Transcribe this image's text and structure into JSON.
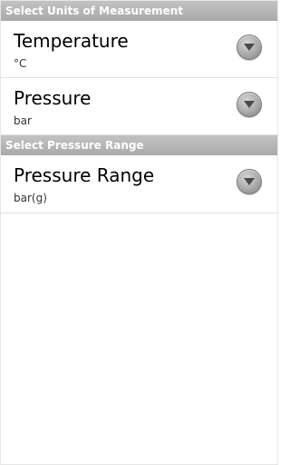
{
  "sections": [
    {
      "header": "Select Units of Measurement",
      "items": [
        {
          "title": "Temperature",
          "summary": "°C",
          "icon": "chevron-down-icon"
        },
        {
          "title": "Pressure",
          "summary": "bar",
          "icon": "chevron-down-icon"
        }
      ]
    },
    {
      "header": "Select Pressure Range",
      "items": [
        {
          "title": "Pressure Range",
          "summary": "bar(g)",
          "icon": "chevron-down-icon"
        }
      ]
    }
  ]
}
